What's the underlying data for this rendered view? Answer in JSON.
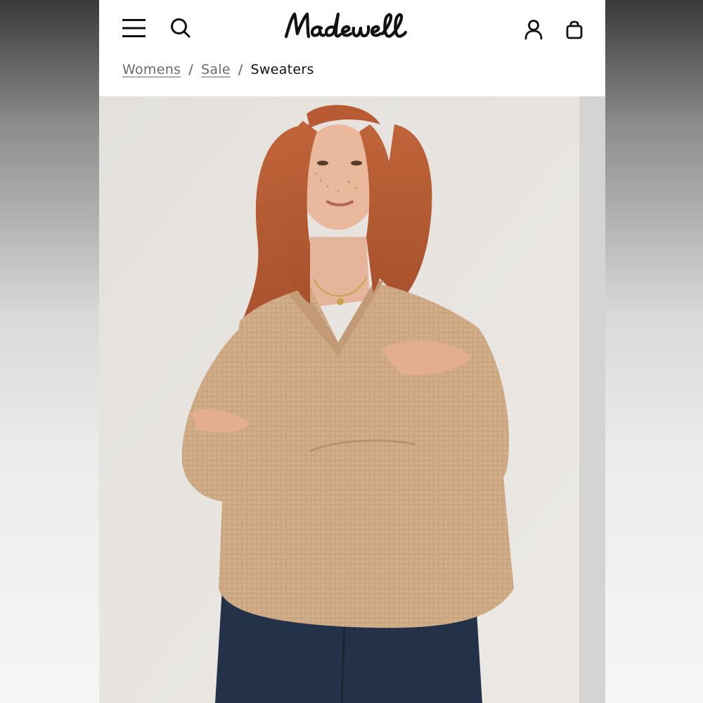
{
  "header": {
    "brand": "Madewell",
    "icons": {
      "menu": "menu-icon",
      "search": "search-icon",
      "account": "account-icon",
      "bag": "shopping-bag-icon"
    }
  },
  "breadcrumb": {
    "items": [
      {
        "label": "Womens",
        "link": true
      },
      {
        "label": "Sale",
        "link": true
      },
      {
        "label": "Sweaters",
        "link": false
      }
    ],
    "separator": "/"
  },
  "product": {
    "image_alt": "Model wearing a tan waffle-knit V-neck sweater with dark jeans"
  },
  "colors": {
    "sweater": "#c9a47f",
    "hair": "#b85a33",
    "jeans": "#233248",
    "background": "#e6e3df"
  }
}
